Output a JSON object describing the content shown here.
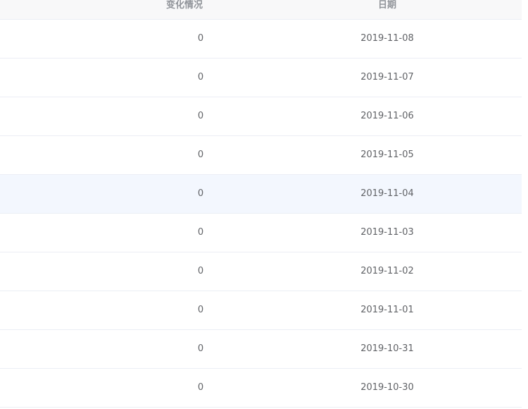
{
  "table": {
    "columns": [
      {
        "key": "change",
        "label": "变化情况"
      },
      {
        "key": "date",
        "label": "日期"
      }
    ],
    "rows": [
      {
        "change": "0",
        "date": "2019-11-08"
      },
      {
        "change": "0",
        "date": "2019-11-07"
      },
      {
        "change": "0",
        "date": "2019-11-06"
      },
      {
        "change": "0",
        "date": "2019-11-05"
      },
      {
        "change": "0",
        "date": "2019-11-04"
      },
      {
        "change": "0",
        "date": "2019-11-03"
      },
      {
        "change": "0",
        "date": "2019-11-02"
      },
      {
        "change": "0",
        "date": "2019-11-01"
      },
      {
        "change": "0",
        "date": "2019-10-31"
      },
      {
        "change": "0",
        "date": "2019-10-30"
      }
    ],
    "hovered_row_index": 4
  },
  "colors": {
    "header_bg": "#f8f8f9",
    "row_hover_bg": "#f3f7fe",
    "border": "#ebeef5",
    "header_text": "#909399",
    "cell_text": "#606266"
  }
}
